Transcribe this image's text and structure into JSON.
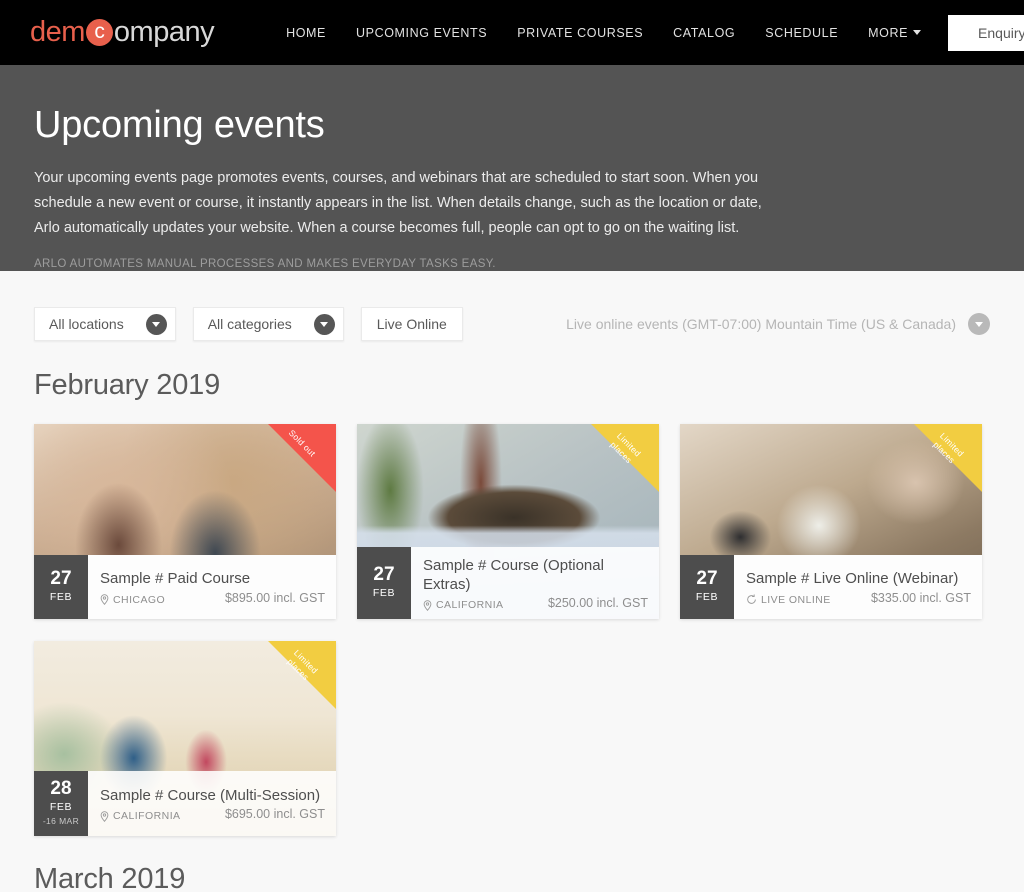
{
  "header": {
    "logo": {
      "part1": "dem",
      "circle": "c",
      "part2": "ompany"
    },
    "nav": [
      {
        "label": "HOME",
        "name": "nav-home"
      },
      {
        "label": "UPCOMING EVENTS",
        "name": "nav-upcoming-events"
      },
      {
        "label": "PRIVATE COURSES",
        "name": "nav-private-courses"
      },
      {
        "label": "CATALOG",
        "name": "nav-catalog"
      },
      {
        "label": "SCHEDULE",
        "name": "nav-schedule"
      }
    ],
    "more_label": "MORE",
    "enquiry_label": "Enquiry",
    "search_icon": "search-icon",
    "cart_icon": "shopping-cart-icon"
  },
  "hero": {
    "title": "Upcoming events",
    "description": "Your upcoming events page promotes events, courses, and webinars that are scheduled to start soon. When you schedule a new event or course, it instantly appears in the list. When details change, such as the location or date, Arlo automatically updates your website. When a course becomes full, people can opt to go on the waiting list.",
    "tagline": "ARLO AUTOMATES MANUAL PROCESSES AND MAKES EVERYDAY TASKS EASY."
  },
  "filters": {
    "locations": "All locations",
    "categories": "All categories",
    "live_online": "Live Online",
    "timezone": "Live online events (GMT-07:00) Mountain Time (US & Canada)"
  },
  "months": {
    "current": "February 2019",
    "next": "March 2019"
  },
  "events": [
    {
      "day": "27",
      "month": "FEB",
      "range": "",
      "title": "Sample # Paid Course",
      "location": "CHICAGO",
      "location_icon": "map-pin-icon",
      "price": "$895.00 incl. GST",
      "ribbon": "Sold out",
      "ribbon_type": "soldout",
      "ribbon_color": "#f4544b",
      "image": "img-cafe",
      "opaque": true
    },
    {
      "day": "27",
      "month": "FEB",
      "range": "",
      "title": "Sample # Course (Optional Extras)",
      "location": "CALIFORNIA",
      "location_icon": "map-pin-icon",
      "price": "$250.00 incl. GST",
      "ribbon": "Limited places",
      "ribbon_type": "limited",
      "ribbon_color": "#f2cd41",
      "image": "img-welcome",
      "opaque": false
    },
    {
      "day": "27",
      "month": "FEB",
      "range": "",
      "title": "Sample # Live Online (Webinar)",
      "location": "LIVE ONLINE",
      "location_icon": "live-online-icon",
      "price": "$335.00 incl. GST",
      "ribbon": "Limited places",
      "ribbon_type": "limited",
      "ribbon_color": "#f2cd41",
      "image": "img-desk",
      "opaque": true
    },
    {
      "day": "28",
      "month": "FEB",
      "range": "-16 MAR",
      "title": "Sample # Course (Multi-Session)",
      "location": "CALIFORNIA",
      "location_icon": "map-pin-icon",
      "price": "$695.00 incl. GST",
      "ribbon": "Limited places",
      "ribbon_type": "limited",
      "ribbon_color": "#f2cd41",
      "image": "img-beach",
      "opaque": false
    }
  ],
  "colors": {
    "brand": "#e8604c",
    "header_bg": "#000000",
    "hero_bg": "#545454",
    "page_bg": "#f8f8f8",
    "soldout": "#f4544b",
    "limited": "#f2cd41",
    "date_badge": "#4d4d4d"
  }
}
